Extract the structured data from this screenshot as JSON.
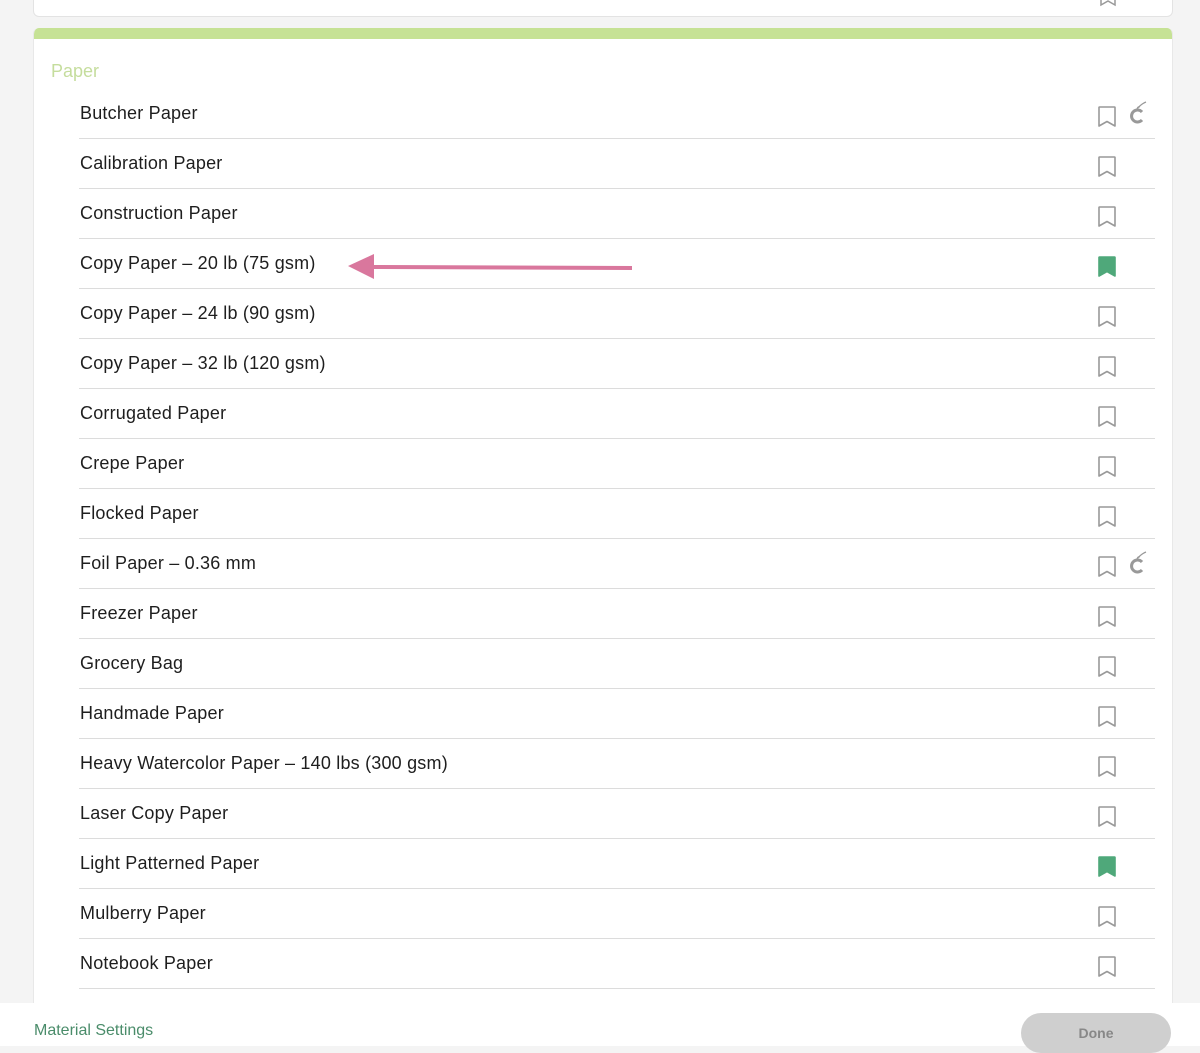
{
  "section": {
    "title": "Paper"
  },
  "colors": {
    "accent": "#c6e295",
    "saved": "#4fa87a",
    "annotation_arrow": "#d9779d"
  },
  "materials": [
    {
      "name": "Butcher Paper",
      "saved": false,
      "cricut_icon": true
    },
    {
      "name": "Calibration Paper",
      "saved": false,
      "cricut_icon": false
    },
    {
      "name": "Construction Paper",
      "saved": false,
      "cricut_icon": false
    },
    {
      "name": "Copy Paper – 20 lb (75 gsm)",
      "saved": true,
      "cricut_icon": false
    },
    {
      "name": "Copy Paper – 24 lb (90 gsm)",
      "saved": false,
      "cricut_icon": false
    },
    {
      "name": "Copy Paper – 32 lb (120 gsm)",
      "saved": false,
      "cricut_icon": false
    },
    {
      "name": "Corrugated Paper",
      "saved": false,
      "cricut_icon": false
    },
    {
      "name": "Crepe Paper",
      "saved": false,
      "cricut_icon": false
    },
    {
      "name": "Flocked Paper",
      "saved": false,
      "cricut_icon": false
    },
    {
      "name": "Foil Paper – 0.36 mm",
      "saved": false,
      "cricut_icon": true
    },
    {
      "name": "Freezer Paper",
      "saved": false,
      "cricut_icon": false
    },
    {
      "name": "Grocery Bag",
      "saved": false,
      "cricut_icon": false
    },
    {
      "name": "Handmade Paper",
      "saved": false,
      "cricut_icon": false
    },
    {
      "name": "Heavy Watercolor Paper – 140 lbs (300 gsm)",
      "saved": false,
      "cricut_icon": false
    },
    {
      "name": "Laser Copy Paper",
      "saved": false,
      "cricut_icon": false
    },
    {
      "name": "Light Patterned Paper",
      "saved": true,
      "cricut_icon": false
    },
    {
      "name": "Mulberry Paper",
      "saved": false,
      "cricut_icon": false
    },
    {
      "name": "Notebook Paper",
      "saved": false,
      "cricut_icon": false
    }
  ],
  "footer": {
    "settings_link": "Material Settings",
    "done_label": "Done"
  }
}
